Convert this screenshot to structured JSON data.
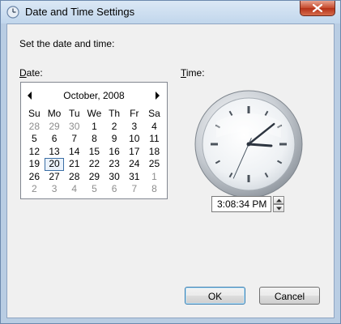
{
  "window": {
    "title": "Date and Time Settings",
    "icons": {
      "app": "clock-app-icon",
      "close": "close-icon"
    }
  },
  "prompt": "Set the date and time:",
  "date_label": {
    "mnemonic": "D",
    "rest": "ate:"
  },
  "time_label": {
    "mnemonic": "T",
    "rest": "ime:"
  },
  "calendar": {
    "month_year": "October, 2008",
    "weekdays": [
      "Su",
      "Mo",
      "Tu",
      "We",
      "Th",
      "Fr",
      "Sa"
    ],
    "selected_day": "20",
    "days": [
      {
        "d": "28",
        "other": true
      },
      {
        "d": "29",
        "other": true
      },
      {
        "d": "30",
        "other": true
      },
      {
        "d": "1"
      },
      {
        "d": "2"
      },
      {
        "d": "3"
      },
      {
        "d": "4"
      },
      {
        "d": "5"
      },
      {
        "d": "6"
      },
      {
        "d": "7"
      },
      {
        "d": "8"
      },
      {
        "d": "9"
      },
      {
        "d": "10"
      },
      {
        "d": "11"
      },
      {
        "d": "12"
      },
      {
        "d": "13"
      },
      {
        "d": "14"
      },
      {
        "d": "15"
      },
      {
        "d": "16"
      },
      {
        "d": "17"
      },
      {
        "d": "18"
      },
      {
        "d": "19"
      },
      {
        "d": "20",
        "selected": true
      },
      {
        "d": "21"
      },
      {
        "d": "22"
      },
      {
        "d": "23"
      },
      {
        "d": "24"
      },
      {
        "d": "25"
      },
      {
        "d": "26"
      },
      {
        "d": "27"
      },
      {
        "d": "28"
      },
      {
        "d": "29"
      },
      {
        "d": "30"
      },
      {
        "d": "31"
      },
      {
        "d": "1",
        "other": true
      },
      {
        "d": "2",
        "other": true
      },
      {
        "d": "3",
        "other": true
      },
      {
        "d": "4",
        "other": true
      },
      {
        "d": "5",
        "other": true
      },
      {
        "d": "6",
        "other": true
      },
      {
        "d": "7",
        "other": true
      },
      {
        "d": "8",
        "other": true
      }
    ]
  },
  "time": {
    "value": "3:08:34 PM",
    "hours": 15,
    "minutes": 8,
    "seconds": 34
  },
  "buttons": {
    "ok": "OK",
    "cancel": "Cancel"
  },
  "colors": {
    "title_bar": "#c1d6ec",
    "close_button": "#c54a2c",
    "dialog_bg": "#f0f0f0",
    "second_hand": "#4a5763"
  }
}
